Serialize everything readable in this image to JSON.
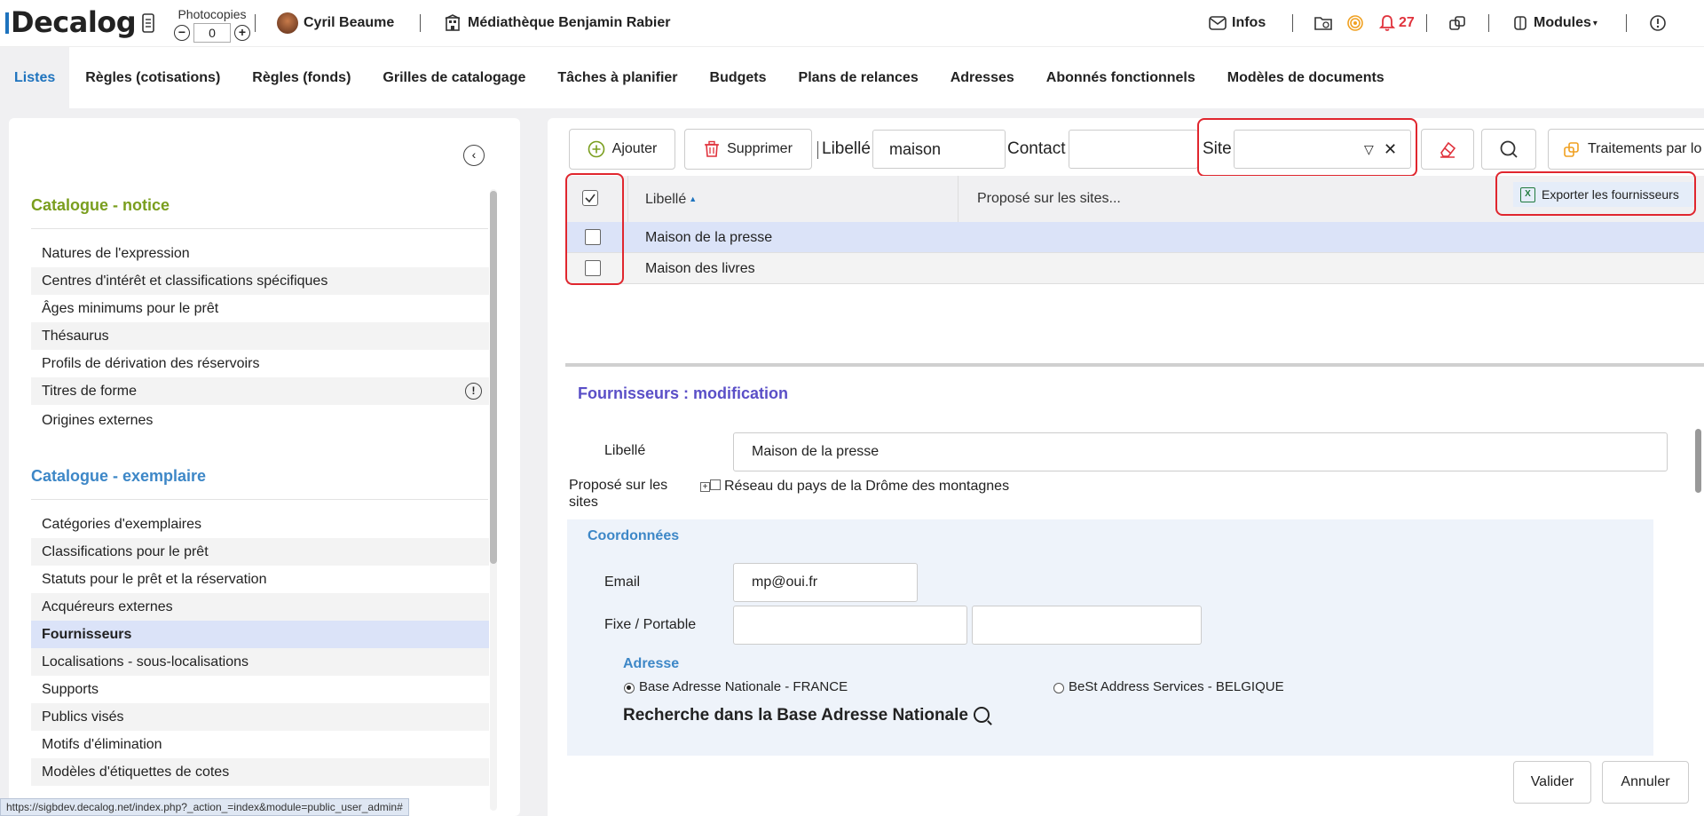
{
  "header": {
    "logo": "Decalog",
    "photocopies_label": "Photocopies",
    "photocopies_value": "0",
    "user_name": "Cyril Beaume",
    "library_name": "Médiathèque Benjamin Rabier",
    "infos_label": "Infos",
    "notifications_count": "27",
    "modules_label": "Modules",
    "minus": "−",
    "plus": "+"
  },
  "tabs": [
    {
      "label": "Listes",
      "active": true
    },
    {
      "label": "Règles (cotisations)"
    },
    {
      "label": "Règles (fonds)"
    },
    {
      "label": "Grilles de catalogage"
    },
    {
      "label": "Tâches à planifier"
    },
    {
      "label": "Budgets"
    },
    {
      "label": "Plans de relances"
    },
    {
      "label": "Adresses"
    },
    {
      "label": "Abonnés fonctionnels"
    },
    {
      "label": "Modèles de documents"
    }
  ],
  "sidebar": {
    "section1_title": "Catalogue - notice",
    "section1_items": [
      "Natures de l'expression",
      "Centres d'intérêt et classifications spécifiques",
      "Âges minimums pour le prêt",
      "Thésaurus",
      "Profils de dérivation des réservoirs",
      "Titres de forme",
      "Origines externes"
    ],
    "section2_title": "Catalogue - exemplaire",
    "section2_items": [
      "Catégories d'exemplaires",
      "Classifications pour le prêt",
      "Statuts pour le prêt et la réservation",
      "Acquéreurs externes",
      "Fournisseurs",
      "Localisations - sous-localisations",
      "Supports",
      "Publics visés",
      "Motifs d'élimination",
      "Modèles d'étiquettes de cotes"
    ],
    "active_item": "Fournisseurs"
  },
  "toolbar": {
    "add_label": "Ajouter",
    "delete_label": "Supprimer",
    "libelle_label": "Libellé",
    "libelle_value": "maison",
    "contact_label": "Contact",
    "contact_value": "",
    "site_label": "Site",
    "site_value": "",
    "treatments_label": "Traitements par lo",
    "export_label": "Exporter les fournisseurs"
  },
  "grid": {
    "col_libelle": "Libellé",
    "col_sites": "Proposé sur les sites...",
    "rows": [
      "Maison de la presse",
      "Maison des livres"
    ]
  },
  "form": {
    "title": "Fournisseurs : modification",
    "libelle_label": "Libellé",
    "libelle_value": "Maison de la presse",
    "sites_label": "Proposé sur les sites",
    "sites_tree_item": "Réseau du pays de la Drôme des montagnes",
    "coord_title": "Coordonnées",
    "email_label": "Email",
    "email_value": "mp@oui.fr",
    "phone_label": "Fixe / Portable",
    "fixe_value": "",
    "portable_value": "",
    "address_title": "Adresse",
    "radio1": "Base Adresse Nationale - FRANCE",
    "radio2": "BeSt Address Services - BELGIQUE",
    "search_title": "Recherche dans la Base Adresse Nationale",
    "validate_label": "Valider",
    "cancel_label": "Annuler"
  },
  "status_url": "https://sigbdev.decalog.net/index.php?_action_=index&module=public_user_admin#"
}
